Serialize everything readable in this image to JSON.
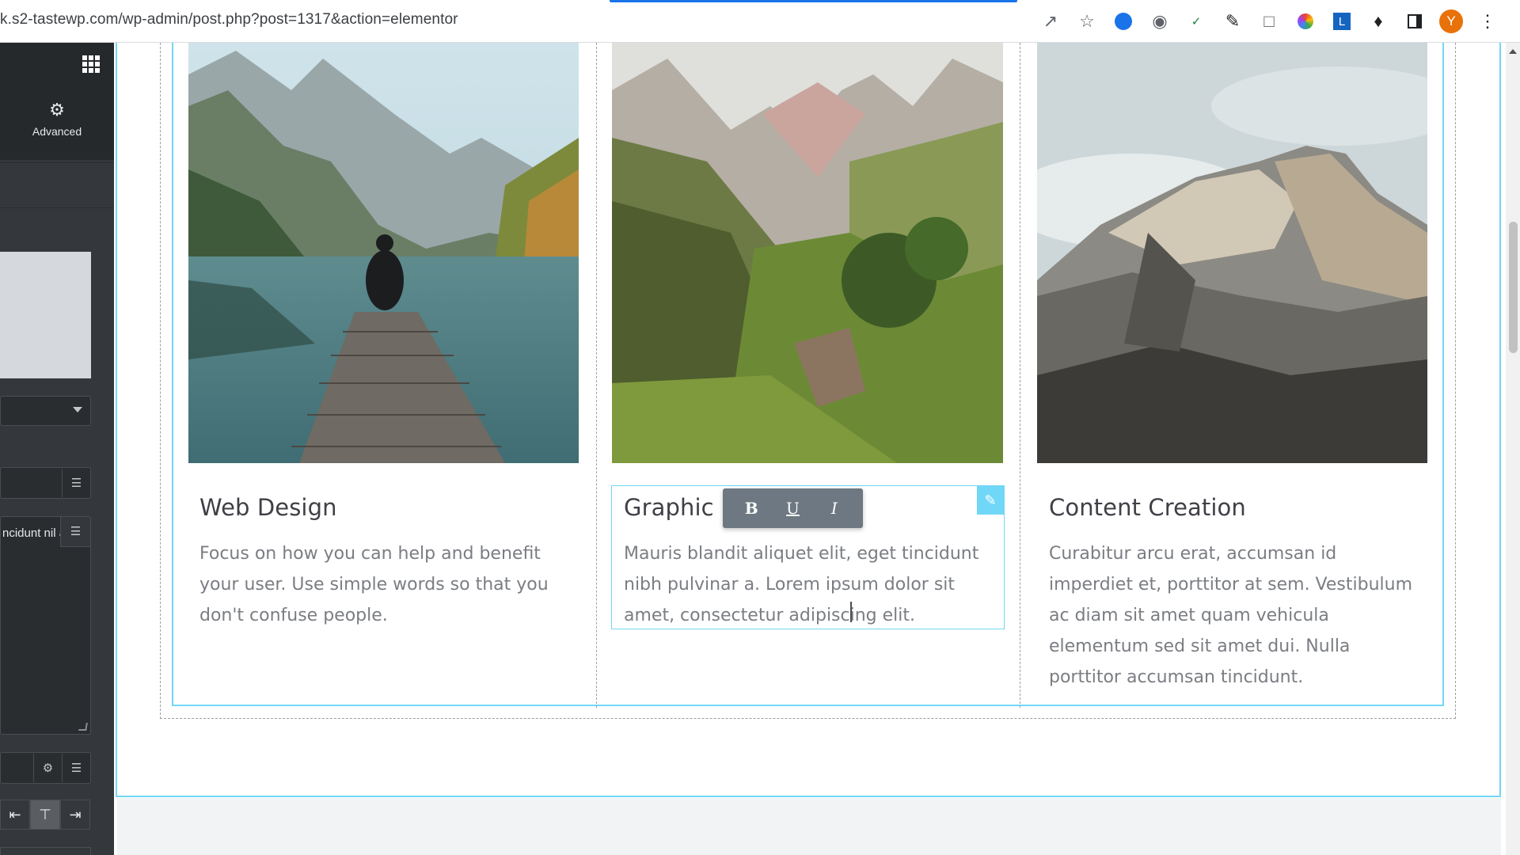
{
  "browser": {
    "url": "k.s2-tastewp.com/wp-admin/post.php?post=1317&action=elementor",
    "profile_initial": "Y",
    "icons": [
      "share-icon",
      "star-icon",
      "extension-blue-icon",
      "camera-icon",
      "abc-check-icon",
      "pen-icon",
      "screen-capture-icon",
      "color-wheel-icon",
      "l-extension-icon",
      "puzzle-icon",
      "sidebar-icon",
      "menu-dots-icon"
    ]
  },
  "panel": {
    "advanced_tab_label": "Advanced",
    "textarea_value": "ncidunt nil amet,"
  },
  "cards": [
    {
      "title": "Web Design",
      "text": "Focus on how you can help and benefit your user. Use simple words so that you don't confuse people."
    },
    {
      "title": "Graphic D",
      "text": "Mauris blandit aliquet elit, eget tincidunt nibh pulvinar a. Lorem ipsum dolor sit amet, consectetur adipiscing elit."
    },
    {
      "title": "Content Creation",
      "text": "Curabitur arcu erat, accumsan id imperdiet et, porttitor at sem. Vestibulum ac diam sit amet quam vehicula elementum sed sit amet dui. Nulla porttitor accumsan tincidunt."
    }
  ],
  "format_toolbar": {
    "bold": "B",
    "underline": "U",
    "italic": "I"
  },
  "colors": {
    "accent": "#71d7f7",
    "panel_bg": "#34383c",
    "text_title": "#3f3f46",
    "text_body": "#7a7d82"
  }
}
